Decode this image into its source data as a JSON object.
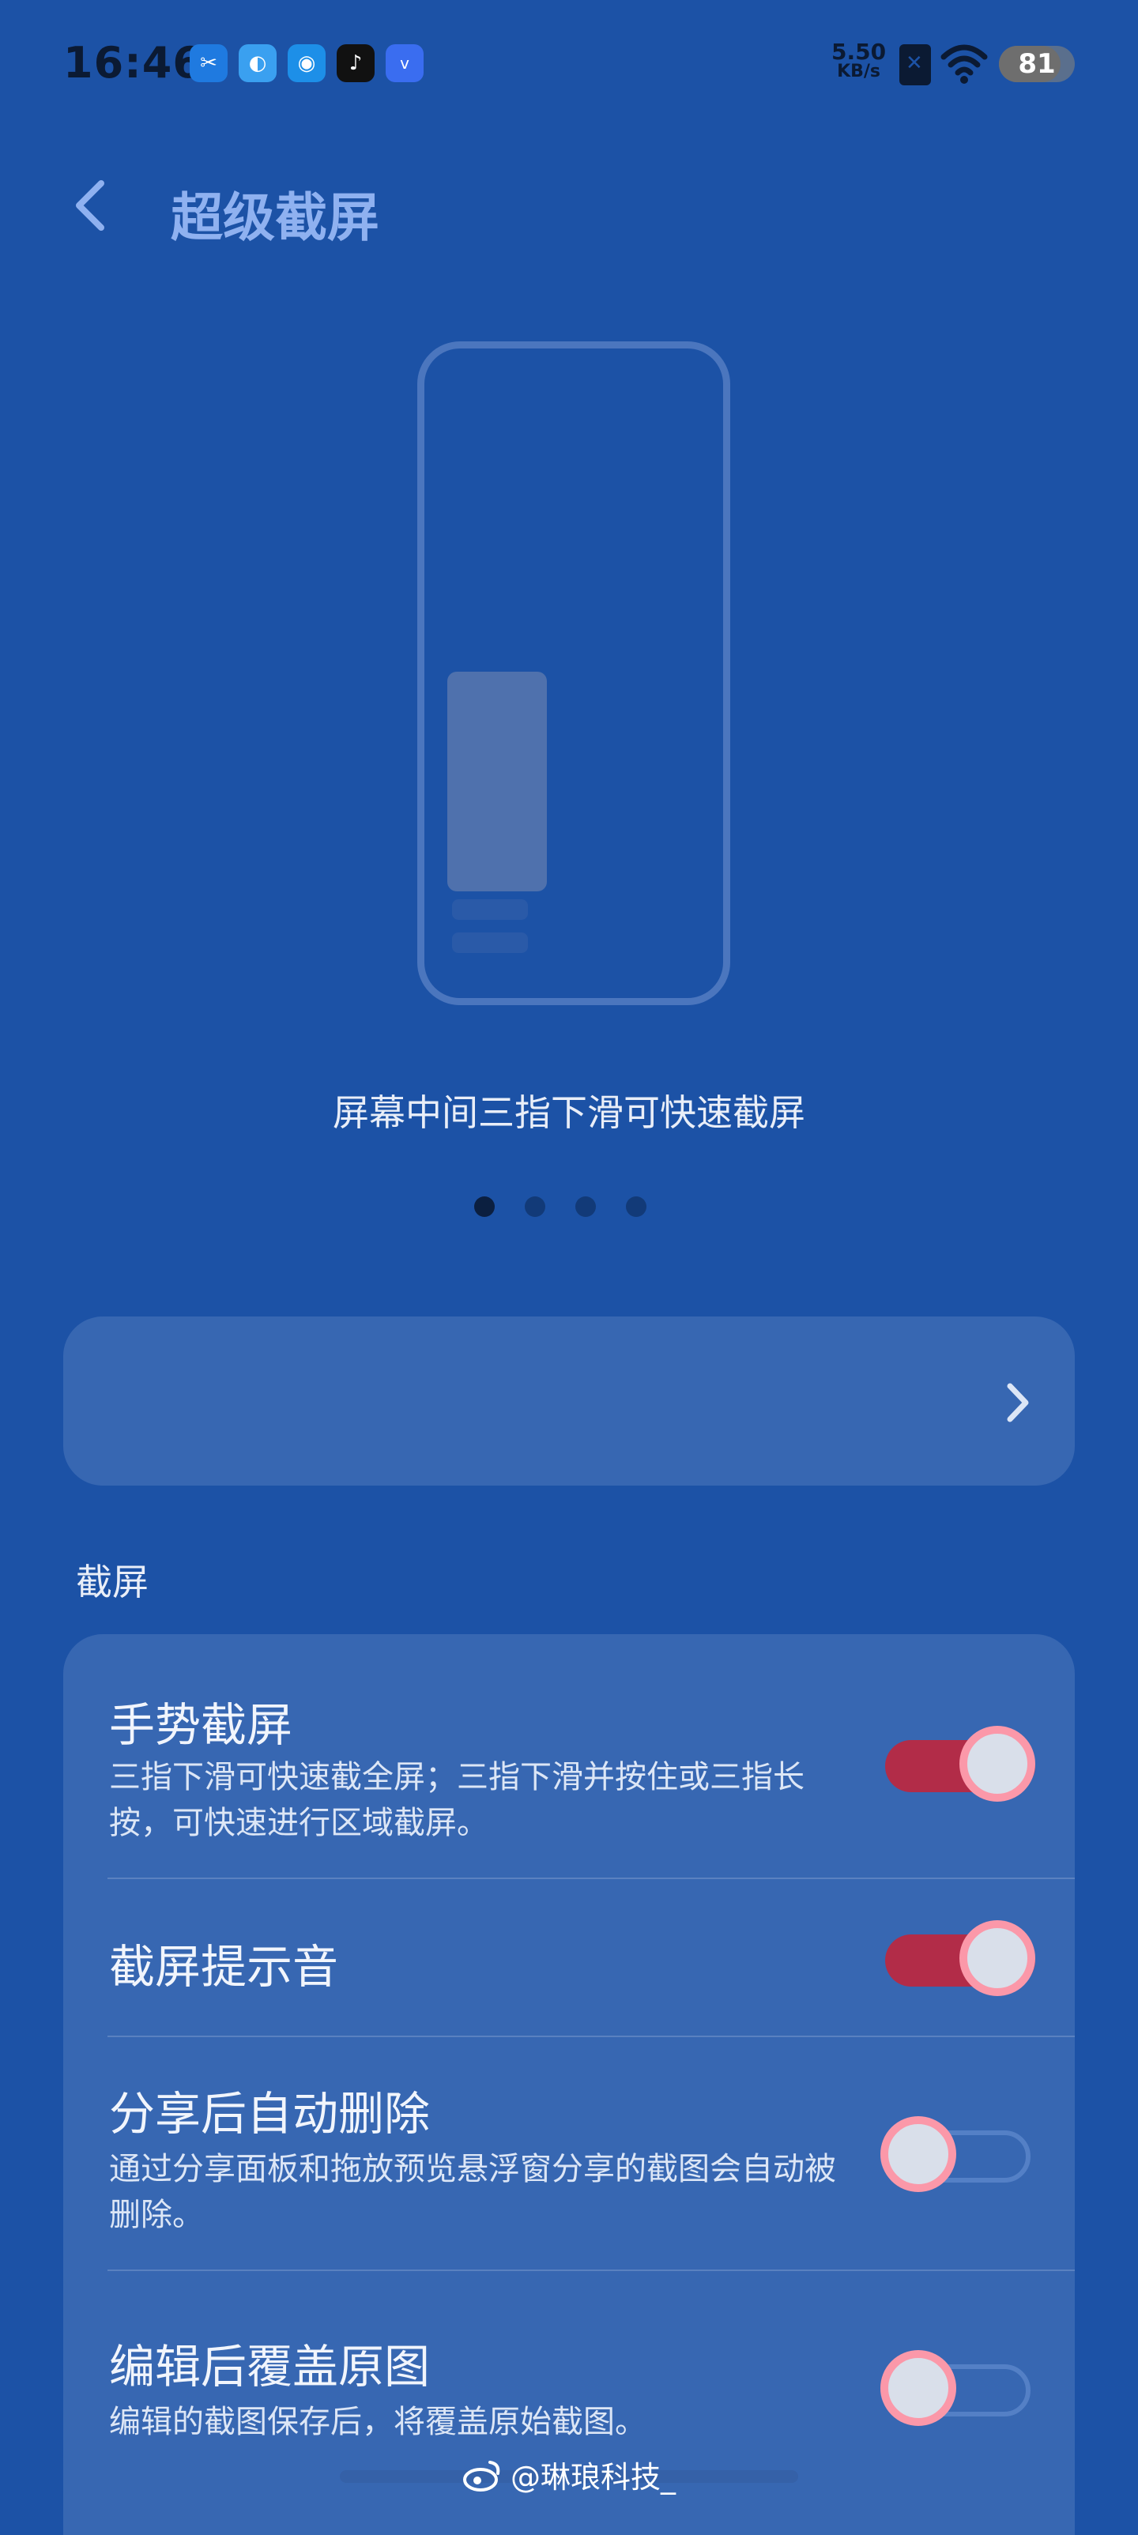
{
  "status_bar": {
    "time": "16:46",
    "net_speed_value": "5.50",
    "net_speed_unit": "KB/s",
    "battery_level": "81",
    "battery_fraction": 0.81,
    "apps": [
      {
        "name": "scissors-app-icon",
        "glyph": "✂",
        "color": "#1f7ae0"
      },
      {
        "name": "browser-app-icon",
        "glyph": "◐",
        "color": "#3aa0f0"
      },
      {
        "name": "planet-app-icon",
        "glyph": "◉",
        "color": "#1d8fe8"
      },
      {
        "name": "tiktok-app-icon",
        "glyph": "♪",
        "color": "#111111"
      },
      {
        "name": "vivo-app-icon",
        "glyph": "v",
        "color": "#3a6df0"
      }
    ]
  },
  "header": {
    "title": "超级截屏"
  },
  "illustration": {
    "caption": "屏幕中间三指下滑可快速截屏",
    "dots_total": 4,
    "dots_active_index": 0
  },
  "link_card": {
    "label": ""
  },
  "section": {
    "label": "截屏",
    "items": [
      {
        "title": "手势截屏",
        "description": "三指下滑可快速截全屏；三指下滑并按住或三指长按，可快速进行区域截屏。",
        "enabled": true
      },
      {
        "title": "截屏提示音",
        "description": "",
        "enabled": true
      },
      {
        "title": "分享后自动删除",
        "description": "通过分享面板和拖放预览悬浮窗分享的截图会自动被删除。",
        "enabled": false
      },
      {
        "title": "编辑后覆盖原图",
        "description": "编辑的截图保存后，将覆盖原始截图。",
        "enabled": false
      }
    ]
  },
  "watermark": {
    "text": "@琳琅科技_"
  },
  "colors": {
    "background": "#1c52a6",
    "card": "#3767b2",
    "title_accent": "#8fb1f0",
    "toggle_on": "#b22c48",
    "toggle_knob_ring": "#fb98a9"
  }
}
